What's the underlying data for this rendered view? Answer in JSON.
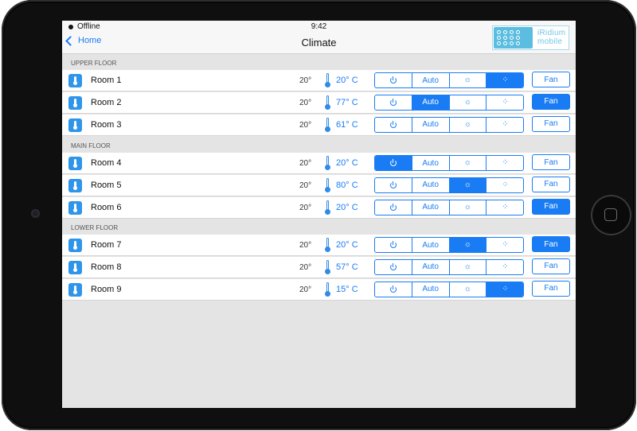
{
  "status": {
    "network": "Offline",
    "time": "9:42"
  },
  "nav": {
    "back_label": "Home",
    "title": "Climate"
  },
  "logo": {
    "line1": "iRidium",
    "line2": "mobile"
  },
  "modes": {
    "power_icon": "power-icon",
    "auto_label": "Auto",
    "heat_icon": "sun-icon",
    "cool_icon": "snowflake-icon"
  },
  "fan_label": "Fan",
  "sections": [
    {
      "title": "UPPER FLOOR",
      "rooms": [
        {
          "name": "Room 1",
          "setpoint": "20°",
          "current": "20° C",
          "mode": "cool",
          "fan_on": false
        },
        {
          "name": "Room 2",
          "setpoint": "20°",
          "current": "77° C",
          "mode": "auto",
          "fan_on": true
        },
        {
          "name": "Room 3",
          "setpoint": "20°",
          "current": "61° C",
          "mode": "none",
          "fan_on": false
        }
      ]
    },
    {
      "title": "MAIN FLOOR",
      "rooms": [
        {
          "name": "Room 4",
          "setpoint": "20°",
          "current": "20° C",
          "mode": "power",
          "fan_on": false
        },
        {
          "name": "Room 5",
          "setpoint": "20°",
          "current": "80° C",
          "mode": "heat",
          "fan_on": false
        },
        {
          "name": "Room 6",
          "setpoint": "20°",
          "current": "20° C",
          "mode": "none",
          "fan_on": true
        }
      ]
    },
    {
      "title": "LOWER FLOOR",
      "rooms": [
        {
          "name": "Room 7",
          "setpoint": "20°",
          "current": "20° C",
          "mode": "heat",
          "fan_on": true
        },
        {
          "name": "Room 8",
          "setpoint": "20°",
          "current": "57° C",
          "mode": "none",
          "fan_on": false
        },
        {
          "name": "Room 9",
          "setpoint": "20°",
          "current": "15° C",
          "mode": "cool",
          "fan_on": false
        }
      ]
    }
  ]
}
